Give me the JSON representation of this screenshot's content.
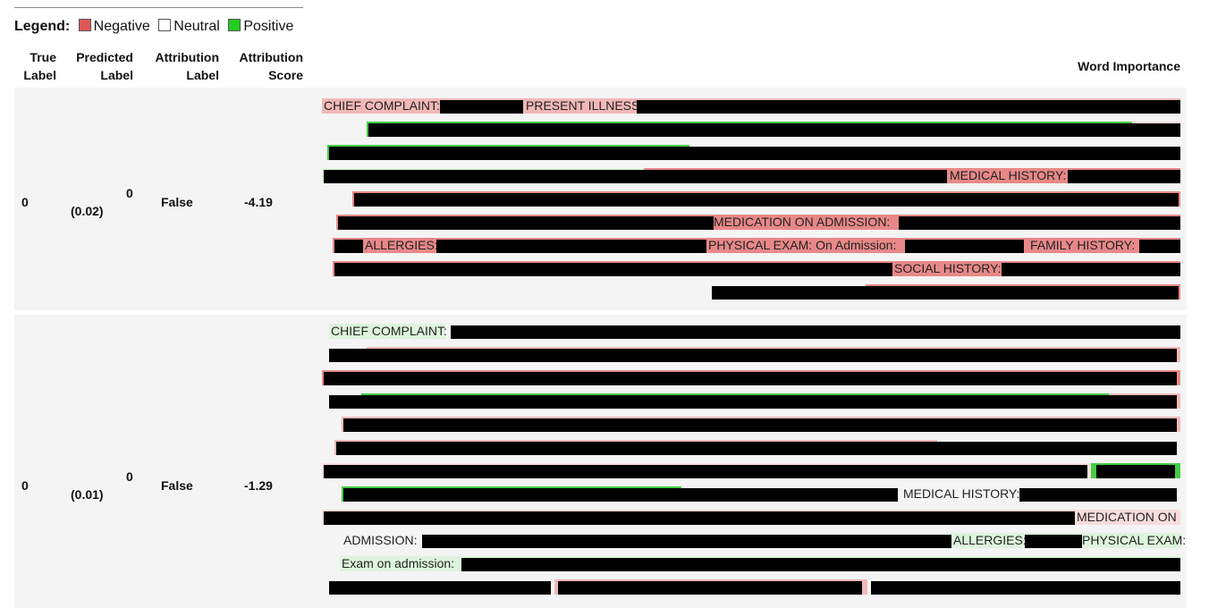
{
  "legend": {
    "title": "Legend:",
    "items": [
      {
        "label": "Negative",
        "color": "#e05555"
      },
      {
        "label": "Neutral",
        "color": "#ffffff"
      },
      {
        "label": "Positive",
        "color": "#22cc22"
      }
    ]
  },
  "headers": {
    "true_label_1": "True",
    "true_label_2": "Label",
    "pred_label_1": "Predicted",
    "pred_label_2": "Label",
    "attr_label_1": "Attribution",
    "attr_label_2": "Label",
    "attr_score_1": "Attribution",
    "attr_score_2": "Score",
    "word_importance": "Word Importance"
  },
  "rows": [
    {
      "true_label": "0",
      "predicted_label": "0",
      "predicted_prob": "(0.02)",
      "attribution_label": "False",
      "attribution_score": "-4.19",
      "labels": {
        "chief_complaint": "CHIEF COMPLAINT:",
        "present_illness": "PRESENT ILLNESS:",
        "medical_history": "MEDICAL HISTORY:",
        "medication_on_admission": "MEDICATION ON ADMISSION:",
        "allergies": "ALLERGIES:",
        "physical_exam": "PHYSICAL EXAM: On Admission:",
        "family_history": "FAMILY HISTORY:",
        "social_history": "SOCIAL HISTORY:"
      }
    },
    {
      "true_label": "0",
      "predicted_label": "0",
      "predicted_prob": "(0.01)",
      "attribution_label": "False",
      "attribution_score": "-1.29",
      "labels": {
        "chief_complaint": "CHIEF COMPLAINT:",
        "medical_history": "MEDICAL HISTORY:",
        "medication_on": "MEDICATION ON",
        "admission": "ADMISSION:",
        "allergies": "ALLERGIES:",
        "physical_exam": "PHYSICAL EXAM:",
        "exam_on_admission": "Exam on admission:"
      }
    }
  ]
}
